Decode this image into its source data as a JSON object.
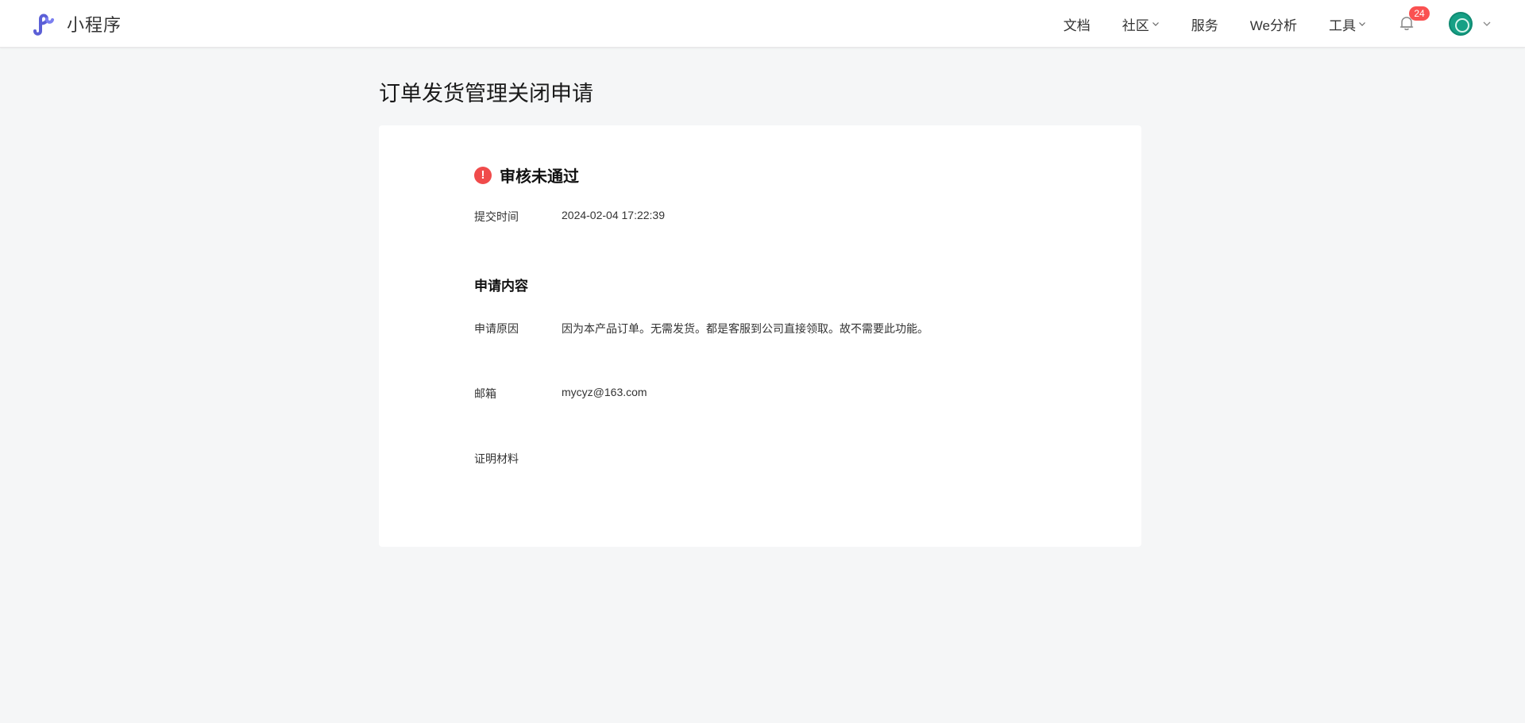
{
  "header": {
    "brand": "小程序",
    "nav": [
      {
        "label": "文档",
        "dropdown": false
      },
      {
        "label": "社区",
        "dropdown": true
      },
      {
        "label": "服务",
        "dropdown": false
      },
      {
        "label": "We分析",
        "dropdown": false
      },
      {
        "label": "工具",
        "dropdown": true
      }
    ],
    "notification_count": "24"
  },
  "page": {
    "title": "订单发货管理关闭申请"
  },
  "status": {
    "icon": "exclamation-icon",
    "mark": "!",
    "text": "审核未通过",
    "color": "#f04b4b"
  },
  "submit": {
    "label": "提交时间",
    "value": "2024-02-04 17:22:39"
  },
  "application": {
    "section_title": "申请内容",
    "reason_label": "申请原因",
    "reason_value": "因为本产品订单。无需发货。都是客服到公司直接领取。故不需要此功能。",
    "email_label": "邮箱",
    "email_value": "mycyz@163.com",
    "proof_label": "证明材料",
    "proof_value": ""
  },
  "colors": {
    "brand": "#5b5fd6",
    "badge": "#fa5151",
    "avatar": "#16a085"
  }
}
